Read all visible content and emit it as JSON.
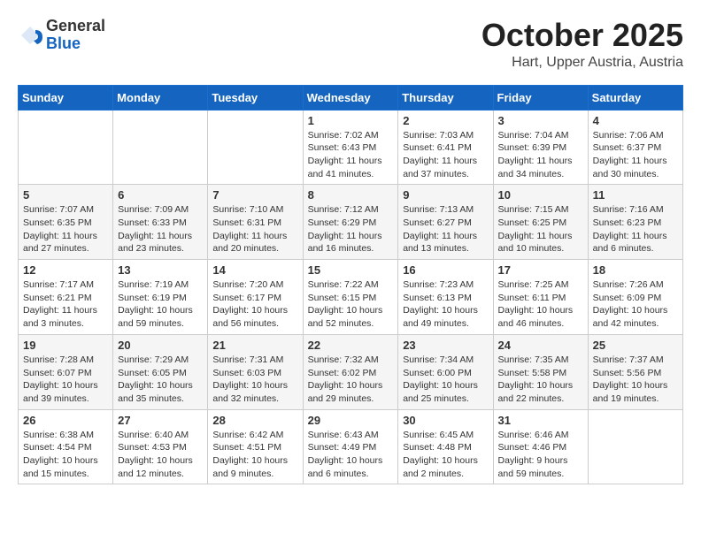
{
  "header": {
    "logo": {
      "line1": "General",
      "line2": "Blue"
    },
    "title": "October 2025",
    "location": "Hart, Upper Austria, Austria"
  },
  "weekdays": [
    "Sunday",
    "Monday",
    "Tuesday",
    "Wednesday",
    "Thursday",
    "Friday",
    "Saturday"
  ],
  "weeks": [
    [
      {
        "day": "",
        "content": ""
      },
      {
        "day": "",
        "content": ""
      },
      {
        "day": "",
        "content": ""
      },
      {
        "day": "1",
        "content": "Sunrise: 7:02 AM\nSunset: 6:43 PM\nDaylight: 11 hours and 41 minutes."
      },
      {
        "day": "2",
        "content": "Sunrise: 7:03 AM\nSunset: 6:41 PM\nDaylight: 11 hours and 37 minutes."
      },
      {
        "day": "3",
        "content": "Sunrise: 7:04 AM\nSunset: 6:39 PM\nDaylight: 11 hours and 34 minutes."
      },
      {
        "day": "4",
        "content": "Sunrise: 7:06 AM\nSunset: 6:37 PM\nDaylight: 11 hours and 30 minutes."
      }
    ],
    [
      {
        "day": "5",
        "content": "Sunrise: 7:07 AM\nSunset: 6:35 PM\nDaylight: 11 hours and 27 minutes."
      },
      {
        "day": "6",
        "content": "Sunrise: 7:09 AM\nSunset: 6:33 PM\nDaylight: 11 hours and 23 minutes."
      },
      {
        "day": "7",
        "content": "Sunrise: 7:10 AM\nSunset: 6:31 PM\nDaylight: 11 hours and 20 minutes."
      },
      {
        "day": "8",
        "content": "Sunrise: 7:12 AM\nSunset: 6:29 PM\nDaylight: 11 hours and 16 minutes."
      },
      {
        "day": "9",
        "content": "Sunrise: 7:13 AM\nSunset: 6:27 PM\nDaylight: 11 hours and 13 minutes."
      },
      {
        "day": "10",
        "content": "Sunrise: 7:15 AM\nSunset: 6:25 PM\nDaylight: 11 hours and 10 minutes."
      },
      {
        "day": "11",
        "content": "Sunrise: 7:16 AM\nSunset: 6:23 PM\nDaylight: 11 hours and 6 minutes."
      }
    ],
    [
      {
        "day": "12",
        "content": "Sunrise: 7:17 AM\nSunset: 6:21 PM\nDaylight: 11 hours and 3 minutes."
      },
      {
        "day": "13",
        "content": "Sunrise: 7:19 AM\nSunset: 6:19 PM\nDaylight: 10 hours and 59 minutes."
      },
      {
        "day": "14",
        "content": "Sunrise: 7:20 AM\nSunset: 6:17 PM\nDaylight: 10 hours and 56 minutes."
      },
      {
        "day": "15",
        "content": "Sunrise: 7:22 AM\nSunset: 6:15 PM\nDaylight: 10 hours and 52 minutes."
      },
      {
        "day": "16",
        "content": "Sunrise: 7:23 AM\nSunset: 6:13 PM\nDaylight: 10 hours and 49 minutes."
      },
      {
        "day": "17",
        "content": "Sunrise: 7:25 AM\nSunset: 6:11 PM\nDaylight: 10 hours and 46 minutes."
      },
      {
        "day": "18",
        "content": "Sunrise: 7:26 AM\nSunset: 6:09 PM\nDaylight: 10 hours and 42 minutes."
      }
    ],
    [
      {
        "day": "19",
        "content": "Sunrise: 7:28 AM\nSunset: 6:07 PM\nDaylight: 10 hours and 39 minutes."
      },
      {
        "day": "20",
        "content": "Sunrise: 7:29 AM\nSunset: 6:05 PM\nDaylight: 10 hours and 35 minutes."
      },
      {
        "day": "21",
        "content": "Sunrise: 7:31 AM\nSunset: 6:03 PM\nDaylight: 10 hours and 32 minutes."
      },
      {
        "day": "22",
        "content": "Sunrise: 7:32 AM\nSunset: 6:02 PM\nDaylight: 10 hours and 29 minutes."
      },
      {
        "day": "23",
        "content": "Sunrise: 7:34 AM\nSunset: 6:00 PM\nDaylight: 10 hours and 25 minutes."
      },
      {
        "day": "24",
        "content": "Sunrise: 7:35 AM\nSunset: 5:58 PM\nDaylight: 10 hours and 22 minutes."
      },
      {
        "day": "25",
        "content": "Sunrise: 7:37 AM\nSunset: 5:56 PM\nDaylight: 10 hours and 19 minutes."
      }
    ],
    [
      {
        "day": "26",
        "content": "Sunrise: 6:38 AM\nSunset: 4:54 PM\nDaylight: 10 hours and 15 minutes."
      },
      {
        "day": "27",
        "content": "Sunrise: 6:40 AM\nSunset: 4:53 PM\nDaylight: 10 hours and 12 minutes."
      },
      {
        "day": "28",
        "content": "Sunrise: 6:42 AM\nSunset: 4:51 PM\nDaylight: 10 hours and 9 minutes."
      },
      {
        "day": "29",
        "content": "Sunrise: 6:43 AM\nSunset: 4:49 PM\nDaylight: 10 hours and 6 minutes."
      },
      {
        "day": "30",
        "content": "Sunrise: 6:45 AM\nSunset: 4:48 PM\nDaylight: 10 hours and 2 minutes."
      },
      {
        "day": "31",
        "content": "Sunrise: 6:46 AM\nSunset: 4:46 PM\nDaylight: 9 hours and 59 minutes."
      },
      {
        "day": "",
        "content": ""
      }
    ]
  ]
}
